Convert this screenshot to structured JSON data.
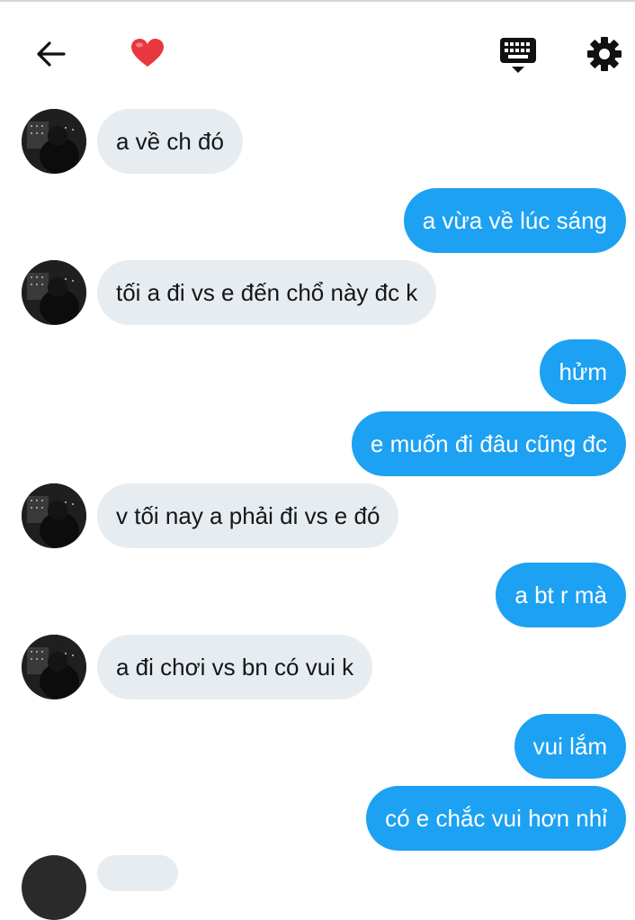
{
  "header": {
    "back_icon": "arrow-left-icon",
    "heart_icon": "heart-icon",
    "keyboard_icon": "keyboard-icon",
    "settings_icon": "gear-icon",
    "accent": "#1da1f2",
    "heart_color": "#e8383d"
  },
  "messages": [
    {
      "side": "in",
      "text": "a về ch đó"
    },
    {
      "side": "out",
      "text": "a vừa về lúc sáng"
    },
    {
      "side": "in",
      "text": "tối a đi vs e đến chổ này đc k"
    },
    {
      "side": "out",
      "text": "hửm"
    },
    {
      "side": "out",
      "text": "e muốn đi đâu cũng đc"
    },
    {
      "side": "in",
      "text": "v tối nay a phải đi vs e đó"
    },
    {
      "side": "out",
      "text": "a bt r mà"
    },
    {
      "side": "in",
      "text": "a đi chơi vs bn có vui k"
    },
    {
      "side": "out",
      "text": "vui lắm"
    },
    {
      "side": "out",
      "text": "có e chắc vui hơn nhỉ"
    }
  ],
  "colors": {
    "incoming_bubble": "#e6ecf0",
    "outgoing_bubble": "#1da1f2",
    "text_dark": "#14171a"
  }
}
